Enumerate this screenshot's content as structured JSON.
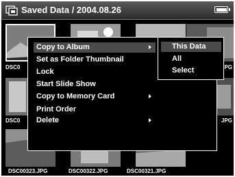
{
  "header": {
    "title": "Saved Data / 2004.08.26",
    "folder_icon": "folder-icon",
    "battery_icon": "battery-icon"
  },
  "thumbnails": [
    {
      "filename": "DSC0"
    },
    {
      "filename": ""
    },
    {
      "filename": ""
    },
    {
      "filename": "JPG"
    },
    {
      "filename": "DSC0"
    },
    {
      "filename": ""
    },
    {
      "filename": ""
    },
    {
      "filename": "JPG"
    },
    {
      "filename": "DSC00323.JPG"
    },
    {
      "filename": "DSC00322.JPG"
    },
    {
      "filename": "DSC00321.JPG"
    }
  ],
  "menu": {
    "items": [
      {
        "label": "Copy to Album",
        "has_submenu": true,
        "selected": true
      },
      {
        "label": "Set as Folder Thumbnail",
        "has_submenu": false
      },
      {
        "label": "Lock",
        "has_submenu": false
      },
      {
        "label": "Start Slide Show",
        "has_submenu": false
      },
      {
        "label": "Copy to Memory Card",
        "has_submenu": true
      },
      {
        "label": "Print Order",
        "has_submenu": false
      },
      {
        "label": "Delete",
        "has_submenu": true
      }
    ]
  },
  "submenu": {
    "items": [
      {
        "label": "This Data",
        "selected": true
      },
      {
        "label": "All"
      },
      {
        "label": "Select"
      }
    ]
  },
  "colors": {
    "background": "#000000",
    "text": "#ffffff",
    "highlight": "#4a4a4a"
  }
}
